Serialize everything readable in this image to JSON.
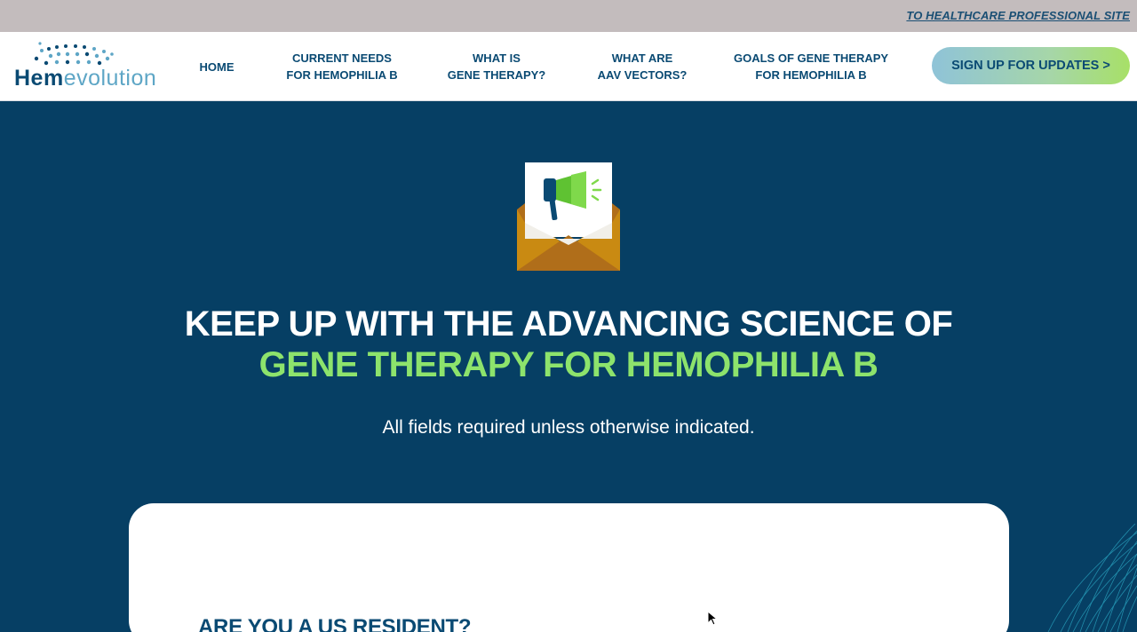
{
  "top_bar": {
    "hcp_link": "TO HEALTHCARE PROFESSIONAL SITE"
  },
  "logo": {
    "hem": "Hem",
    "evo": "evolution"
  },
  "nav": {
    "items": [
      {
        "line1": "HOME",
        "line2": ""
      },
      {
        "line1": "CURRENT NEEDS",
        "line2": "FOR HEMOPHILIA B"
      },
      {
        "line1": "WHAT IS",
        "line2": "GENE THERAPY?"
      },
      {
        "line1": "WHAT ARE",
        "line2": "AAV VECTORS?"
      },
      {
        "line1": "GOALS OF GENE THERAPY",
        "line2": "FOR HEMOPHILIA B"
      }
    ],
    "cta": "SIGN UP FOR UPDATES >"
  },
  "hero": {
    "icon": "megaphone-envelope-icon",
    "headline_line1": "KEEP UP WITH THE ADVANCING SCIENCE OF",
    "headline_line2": "GENE THERAPY FOR HEMOPHILIA B",
    "note": "All fields required unless otherwise indicated."
  },
  "form": {
    "question": "ARE YOU A US RESIDENT?"
  },
  "colors": {
    "navy": "#063f64",
    "accent_green": "#8de36c",
    "text_blue": "#0a4a73",
    "top_bar": "#c3bcbd"
  }
}
